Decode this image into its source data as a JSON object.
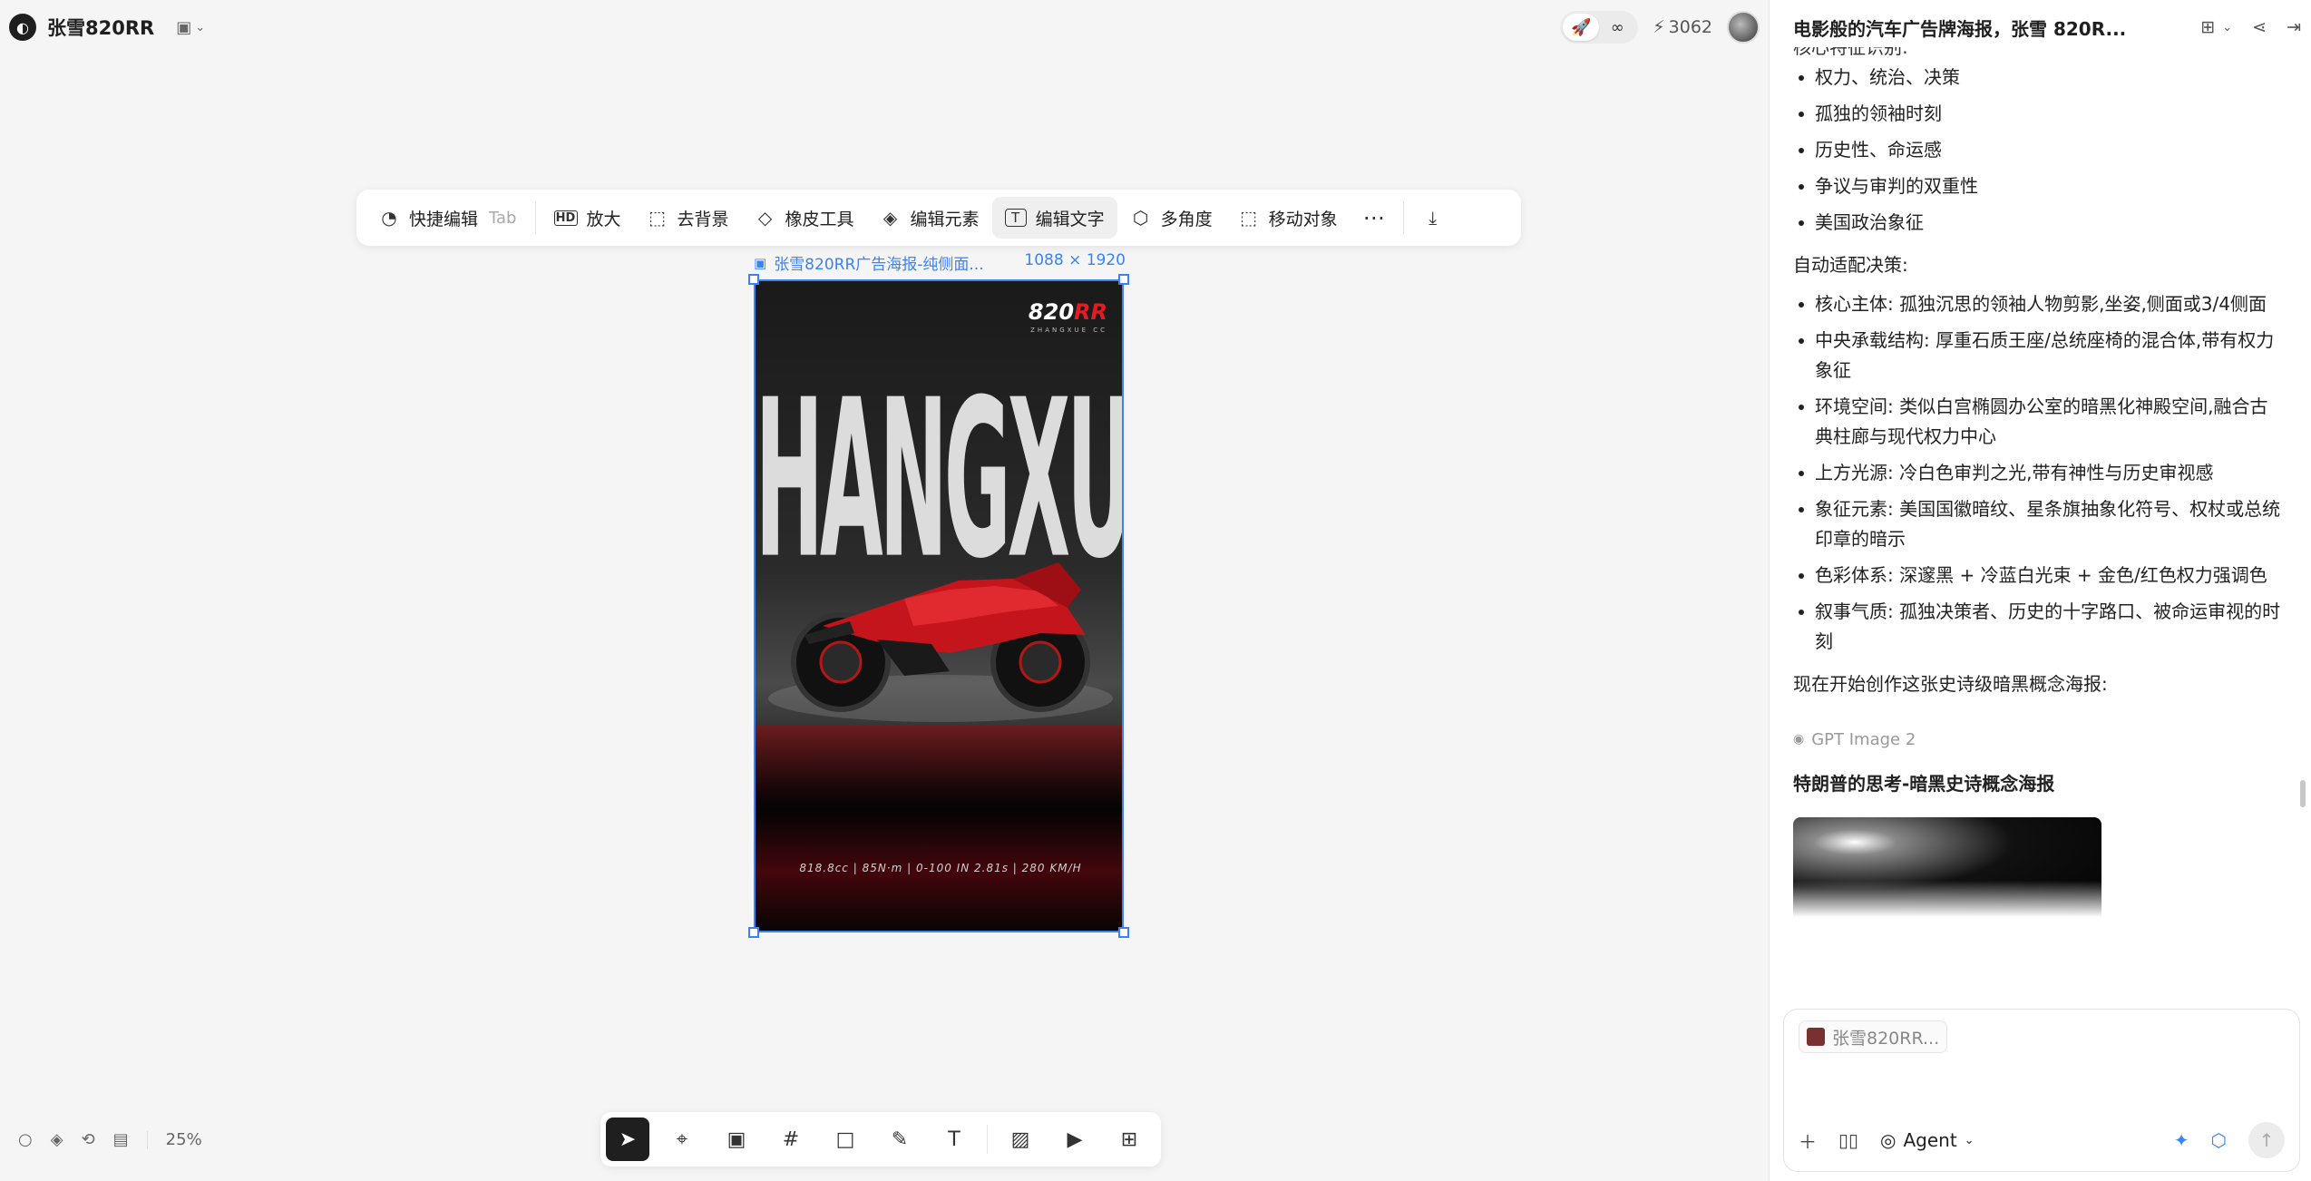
{
  "app": {
    "project_name": "张雪820RR",
    "credits": "3062",
    "toggle": [
      "🚀",
      "∞"
    ]
  },
  "edit_toolbar": {
    "items": [
      {
        "label": "快捷编辑",
        "hint": "Tab",
        "icon": "quick-edit-icon",
        "glyph": "◔"
      },
      {
        "label": "放大",
        "icon": "hd-icon",
        "glyph": "HD"
      },
      {
        "label": "去背景",
        "icon": "remove-bg-icon",
        "glyph": "⬚"
      },
      {
        "label": "橡皮工具",
        "icon": "eraser-icon",
        "glyph": "◇"
      },
      {
        "label": "编辑元素",
        "icon": "layers-icon",
        "glyph": "◈"
      },
      {
        "label": "编辑文字",
        "icon": "edit-text-icon",
        "glyph": "T"
      },
      {
        "label": "多角度",
        "icon": "cube-icon",
        "glyph": "⬡"
      },
      {
        "label": "移动对象",
        "icon": "move-object-icon",
        "glyph": "⬚"
      }
    ],
    "active_index": 5
  },
  "image": {
    "name": "张雪820RR广告海报-纯侧面...",
    "dimensions": "1088 × 1920",
    "poster_title": "ZHANGXUE",
    "poster_logo_white": "820",
    "poster_logo_red": "RR",
    "poster_logo_sub": "ZHANGXUE CC",
    "poster_specs": "818.8cc | 85N·m | 0-100 IN 2.81s | 280 KM/H"
  },
  "zoom": "25%",
  "panel": {
    "title": "电影般的汽车广告牌海报，张雪 820R...",
    "cut_line": "核心特征识别:",
    "features": [
      "权力、统治、决策",
      "孤独的领袖时刻",
      "历史性、命运感",
      "争议与审判的双重性",
      "美国政治象征"
    ],
    "decision_heading": "自动适配决策:",
    "decisions": [
      "核心主体: 孤独沉思的领袖人物剪影,坐姿,侧面或3/4侧面",
      "中央承载结构: 厚重石质王座/总统座椅的混合体,带有权力象征",
      "环境空间: 类似白宫椭圆办公室的暗黑化神殿空间,融合古典柱廊与现代权力中心",
      "上方光源: 冷白色审判之光,带有神性与历史审视感",
      "象征元素: 美国国徽暗纹、星条旗抽象化符号、权杖或总统印章的暗示",
      "色彩体系: 深邃黑 + 冷蓝白光束 + 金色/红色权力强调色",
      "叙事气质: 孤独决策者、历史的十字路口、被命运审视的时刻"
    ],
    "closing": "现在开始创作这张史诗级暗黑概念海报:",
    "model": "GPT Image 2",
    "generation_title": "特朗普的思考-暗黑史诗概念海报"
  },
  "composer": {
    "ref_chip": "张雪820RR...",
    "agent_label": "Agent"
  }
}
